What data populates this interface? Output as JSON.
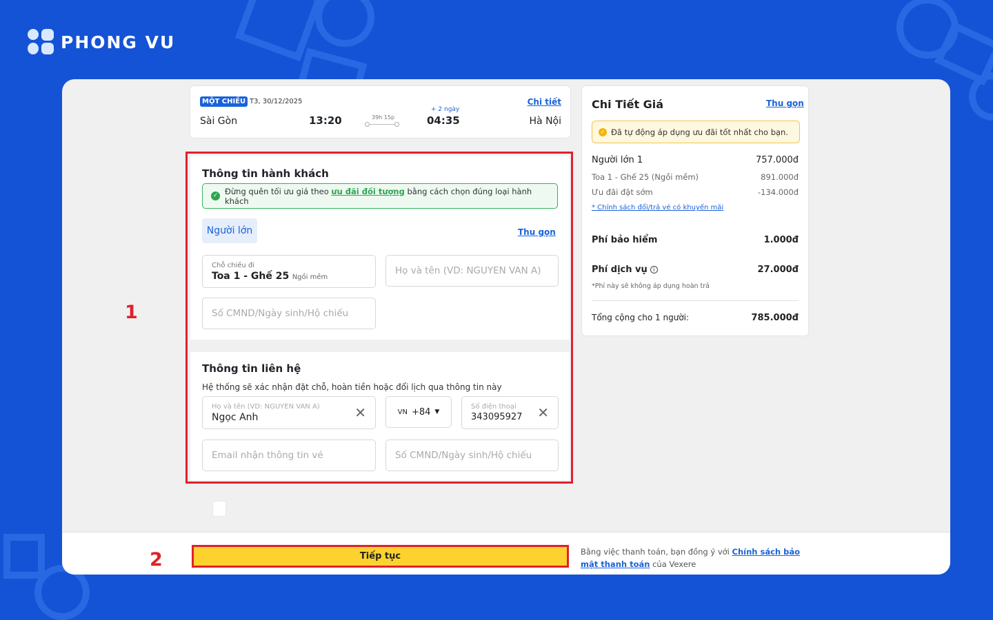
{
  "brand": {
    "name": "PHONG VU"
  },
  "colors": {
    "accent": "#1a62d8",
    "background": "#1453d6",
    "highlight_red": "#e0202b",
    "button_yellow": "#fdd22f"
  },
  "trip": {
    "badge": "MỘT CHIỀU",
    "date": "T3, 30/12/2025",
    "detail_link": "Chi tiết",
    "from": "Sài Gòn",
    "departure_time": "13:20",
    "duration": "39h 15p",
    "plus_days": "+ 2 ngày",
    "arrival_time": "04:35",
    "to": "Hà Nội"
  },
  "passenger": {
    "title": "Thông tin hành khách",
    "notice_before": "Đừng quên tối ưu giá theo",
    "notice_link": "ưu đãi đối tượng",
    "notice_after": "bằng cách chọn đúng loại hành khách",
    "type_label": "Người lớn",
    "collapse_label": "Thu gọn",
    "seat_label": "Chỗ chiều đi",
    "seat_value": "Toa 1 - Ghế 25",
    "seat_type": "Ngồi mềm",
    "name_placeholder": "Họ và tên (VD: NGUYEN VAN A)",
    "id_placeholder": "Số CMND/Ngày sinh/Hộ chiếu"
  },
  "contact": {
    "title": "Thông tin liên hệ",
    "subtitle": "Hệ thống sẽ xác nhận đặt chỗ, hoàn tiền hoặc đổi lịch qua thông tin này",
    "name_label": "Họ và tên (VD: NGUYEN VAN A)",
    "name_value": "Ngọc Anh",
    "country_code": "VN",
    "dial_code": "+84",
    "phone_label": "Số điện thoại",
    "phone_value": "343095927",
    "email_placeholder": "Email nhận thông tin vé",
    "id_placeholder": "Số CMND/Ngày sinh/Hộ chiếu"
  },
  "price": {
    "title": "Chi Tiết Giá",
    "collapse_label": "Thu gọn",
    "note": "Đã tự động áp dụng ưu đãi tốt nhất cho bạn.",
    "adult_label": "Người lớn 1",
    "adult_total": "757.000đ",
    "seat_label": "Toa 1 - Ghế 25 (Ngồi mềm)",
    "seat_price": "891.000đ",
    "early_label": "Ưu đãi đặt sớm",
    "early_discount": "-134.000đ",
    "policy_link": "* Chính sách đổi/trả vé có khuyến mãi",
    "insurance_label": "Phí bảo hiểm",
    "insurance_value": "1.000đ",
    "service_label": "Phí dịch vụ",
    "service_value": "27.000đ",
    "service_note": "*Phí này sẽ không áp dụng hoàn trả",
    "total_label": "Tổng cộng cho 1 người:",
    "total_value": "785.000đ"
  },
  "footer": {
    "continue_label": "Tiếp tục",
    "terms_before": "Bằng việc thanh toán, bạn đồng ý với",
    "terms_link": "Chính sách bảo mật thanh toán",
    "terms_after": "của Vexere"
  },
  "markers": {
    "one": "1",
    "two": "2"
  }
}
